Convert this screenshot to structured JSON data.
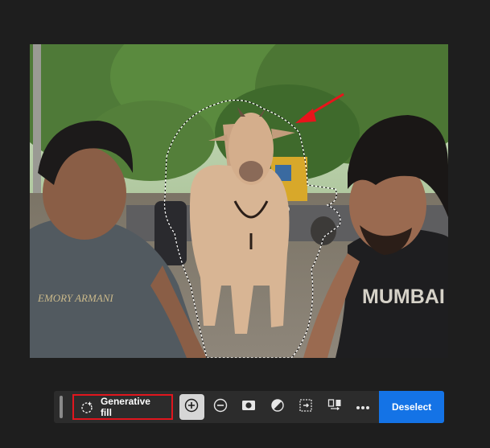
{
  "toolbar": {
    "generative_fill_label": "Generative fill",
    "deselect_label": "Deselect",
    "tools": [
      {
        "name": "add-to-selection",
        "icon": "plus-circle-icon",
        "active": true
      },
      {
        "name": "subtract-from-selection",
        "icon": "minus-circle-icon",
        "active": false
      },
      {
        "name": "mask",
        "icon": "mask-icon",
        "active": false
      },
      {
        "name": "invert-selection",
        "icon": "invert-icon",
        "active": false
      },
      {
        "name": "transform-selection",
        "icon": "transform-icon",
        "active": false
      },
      {
        "name": "swap-selection",
        "icon": "swap-icon",
        "active": false
      },
      {
        "name": "more-options",
        "icon": "more-icon",
        "active": false
      }
    ]
  },
  "photo": {
    "shirt_left_text": "EMORY ARMANI",
    "shirt_right_text": "MUMBAI"
  },
  "colors": {
    "accent": "#1473e6",
    "highlight": "#e0161e",
    "arrow": "#e8141b",
    "toolbar_bg": "#2c2c2c",
    "page_bg": "#1e1e1e"
  }
}
